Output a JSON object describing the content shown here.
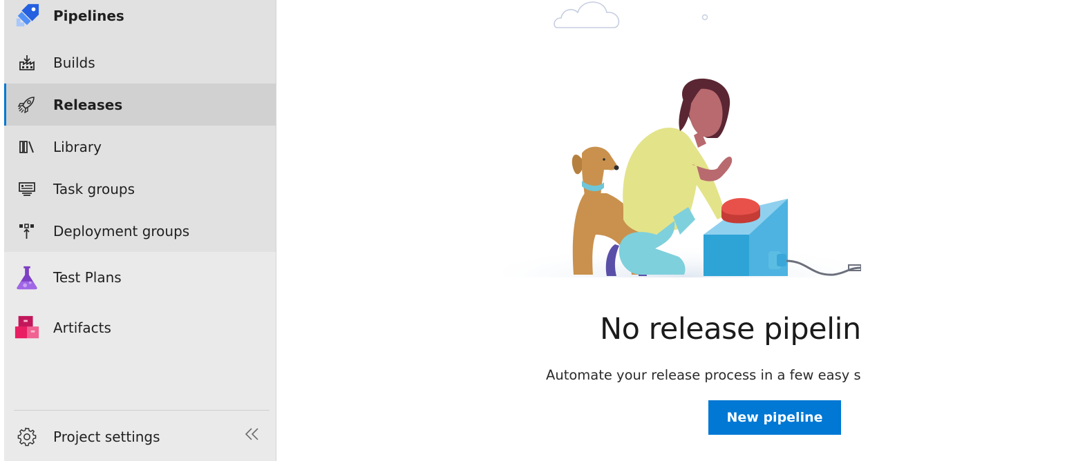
{
  "sidebar": {
    "items": [
      {
        "label": "Pipelines",
        "icon": "pipelines-icon"
      },
      {
        "label": "Builds",
        "icon": "builds-icon"
      },
      {
        "label": "Releases",
        "icon": "releases-rocket-icon",
        "selected": true
      },
      {
        "label": "Library",
        "icon": "library-icon"
      },
      {
        "label": "Task groups",
        "icon": "task-groups-icon"
      },
      {
        "label": "Deployment groups",
        "icon": "deployment-groups-icon"
      },
      {
        "label": "Test Plans",
        "icon": "test-plans-flask-icon"
      },
      {
        "label": "Artifacts",
        "icon": "artifacts-icon"
      }
    ],
    "settings_label": "Project settings",
    "collapse_icon": "double-chevron-left-icon"
  },
  "main": {
    "empty_title": "No release pipelines",
    "empty_description": "Automate your release process in a few easy steps",
    "new_pipeline_label": "New pipeline"
  },
  "colors": {
    "accent": "#0078d4",
    "sidebar_bg": "#eaeaea",
    "selected_bg": "#d1d1d1"
  }
}
